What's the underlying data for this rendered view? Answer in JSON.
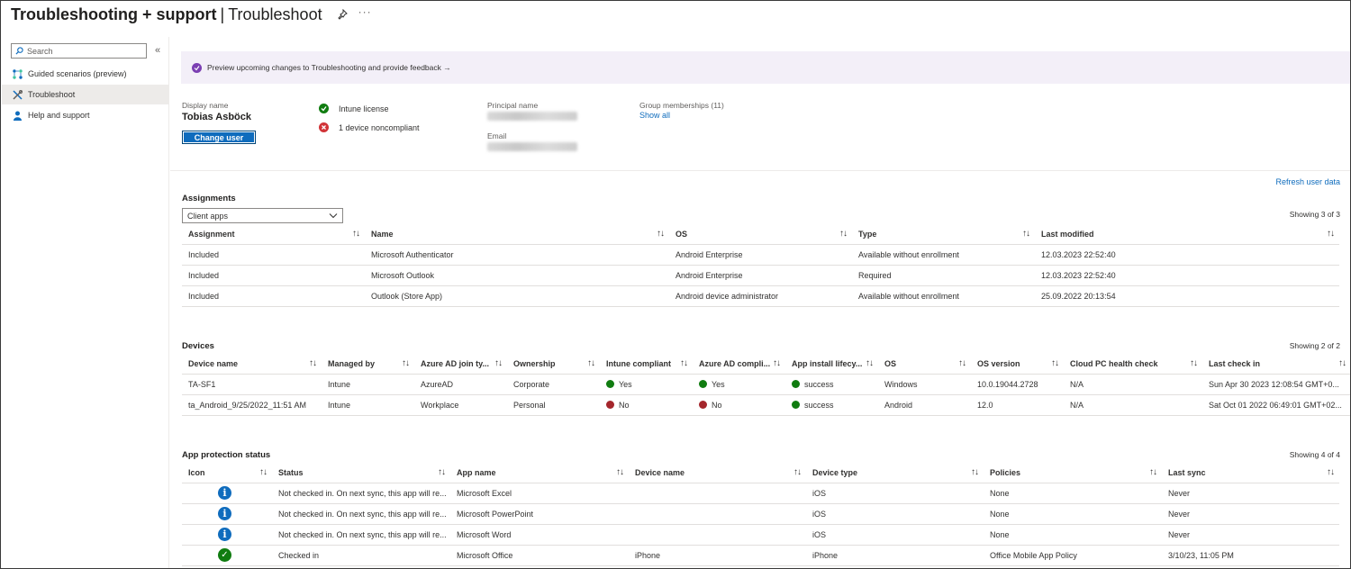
{
  "header": {
    "title": "Troubleshooting + support",
    "separator": "|",
    "subtitle": "Troubleshoot",
    "more": "···"
  },
  "sidebar": {
    "search_placeholder": "Search",
    "collapse": "«",
    "items": [
      {
        "label": "Guided scenarios (preview)",
        "icon": "guided-scenarios-icon"
      },
      {
        "label": "Troubleshoot",
        "icon": "troubleshoot-icon",
        "active": true
      },
      {
        "label": "Help and support",
        "icon": "help-support-icon"
      }
    ]
  },
  "banner": {
    "text": "Preview upcoming changes to Troubleshooting and provide feedback →"
  },
  "user": {
    "display_name_label": "Display name",
    "display_name": "Tobias Asböck",
    "change_user": "Change user",
    "license_status": "Intune license",
    "compliance_status": "1 device noncompliant",
    "principal_name_label": "Principal name",
    "email_label": "Email",
    "group_label": "Group memberships (11)",
    "show_all": "Show all",
    "refresh": "Refresh user data"
  },
  "assignments": {
    "title": "Assignments",
    "filter": "Client apps",
    "showing": "Showing 3 of 3",
    "columns": [
      "Assignment",
      "Name",
      "OS",
      "Type",
      "Last modified"
    ],
    "rows": [
      [
        "Included",
        "Microsoft Authenticator",
        "Android Enterprise",
        "Available without enrollment",
        "12.03.2023 22:52:40"
      ],
      [
        "Included",
        "Microsoft Outlook",
        "Android Enterprise",
        "Required",
        "12.03.2023 22:52:40"
      ],
      [
        "Included",
        "Outlook (Store App)",
        "Android device administrator",
        "Available without enrollment",
        "25.09.2022 20:13:54"
      ]
    ]
  },
  "devices": {
    "title": "Devices",
    "showing": "Showing 2 of 2",
    "columns": [
      "Device name",
      "Managed by",
      "Azure AD join ty...",
      "Ownership",
      "Intune compliant",
      "Azure AD compli...",
      "App install lifecy...",
      "OS",
      "OS version",
      "Cloud PC health check",
      "Last check in"
    ],
    "rows": [
      [
        "TA-SF1",
        "Intune",
        "AzureAD",
        "Corporate",
        "Yes",
        "Yes",
        "success",
        "Windows",
        "10.0.19044.2728",
        "N/A",
        "Sun Apr 30 2023 12:08:54 GMT+0..."
      ],
      [
        "ta_Android_9/25/2022_11:51 AM",
        "Intune",
        "Workplace",
        "Personal",
        "No",
        "No",
        "success",
        "Android",
        "12.0",
        "N/A",
        "Sat Oct 01 2022 06:49:01 GMT+02..."
      ]
    ]
  },
  "app_protection": {
    "title": "App protection status",
    "showing": "Showing 4 of 4",
    "columns": [
      "Icon",
      "Status",
      "App name",
      "Device name",
      "Device type",
      "Policies",
      "Last sync"
    ],
    "rows": [
      [
        "info",
        "Not checked in. On next sync, this app will re...",
        "Microsoft Excel",
        "",
        "iOS",
        "None",
        "Never"
      ],
      [
        "info",
        "Not checked in. On next sync, this app will re...",
        "Microsoft PowerPoint",
        "",
        "iOS",
        "None",
        "Never"
      ],
      [
        "info",
        "Not checked in. On next sync, this app will re...",
        "Microsoft Word",
        "",
        "iOS",
        "None",
        "Never"
      ],
      [
        "ok",
        "Checked in",
        "Microsoft Office",
        "iPhone",
        "iPhone",
        "Office Mobile App Policy",
        "3/10/23, 11:05 PM"
      ]
    ]
  },
  "colors": {
    "accent": "#0f6cbd",
    "success": "#107c10",
    "error": "#a4262c",
    "banner": "#f3eff8",
    "purple": "#7b3fb2"
  }
}
